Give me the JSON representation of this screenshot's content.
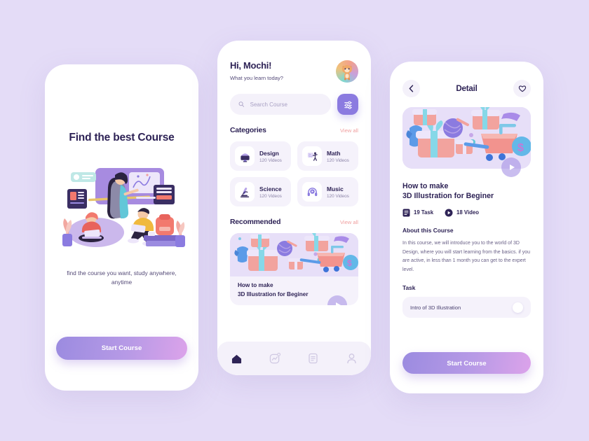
{
  "theme": {
    "background": "#E4DCF7",
    "card": "#FFFFFF",
    "accent_purple": "#8B7BE0",
    "accent_pink": "#DCA3EA",
    "text_dark": "#2E2356",
    "text_muted": "#6B6288",
    "link_pink": "#F0A0A0",
    "soft_lavender": "#F5F2FB"
  },
  "onboarding": {
    "title": "Find the best Course",
    "subtitle": "find the course you want, study anywhere, anytime",
    "cta_label": "Start Course",
    "illustration_name": "online-learning-illustration"
  },
  "home": {
    "greeting": "Hi, Mochi!",
    "greeting_sub": "What you learn today?",
    "avatar_name": "user-avatar-cat",
    "search": {
      "placeholder": "Search Course",
      "value": "",
      "icon": "search-icon"
    },
    "filter_icon": "sliders-filter-icon",
    "categories_section": {
      "title": "Categories",
      "view_all": "View all"
    },
    "categories": [
      {
        "name": "Design",
        "count": "120 Videos",
        "icon": "design-monitor-icon"
      },
      {
        "name": "Math",
        "count": "120 Videos",
        "icon": "math-whiteboard-icon"
      },
      {
        "name": "Science",
        "count": "120 Videos",
        "icon": "science-microscope-icon"
      },
      {
        "name": "Music",
        "count": "120 Videos",
        "icon": "music-headphones-icon"
      }
    ],
    "recommended_section": {
      "title": "Recommended",
      "view_all": "View all"
    },
    "recommended_card": {
      "line1": "How to make",
      "line2": "3D Illustration for Beginer",
      "thumbnail_name": "3d-gifts-illustration",
      "play_icon": "play-icon"
    },
    "bottom_nav": [
      {
        "name": "home-icon",
        "active": true
      },
      {
        "name": "activity-icon",
        "active": false
      },
      {
        "name": "document-icon",
        "active": false
      },
      {
        "name": "profile-icon",
        "active": false
      }
    ]
  },
  "detail": {
    "back_icon": "chevron-left-icon",
    "header_title": "Detail",
    "favorite_icon": "heart-icon",
    "hero_name": "3d-gifts-illustration",
    "play_icon": "play-icon",
    "course_title_line1": "How to make",
    "course_title_line2": "3D Illustration for Beginer",
    "stats": [
      {
        "label": "19 Task",
        "icon": "task-list-icon"
      },
      {
        "label": "18 Video",
        "icon": "play-circle-icon"
      }
    ],
    "about_heading": "About this Course",
    "about_text": "In this course, we will introduce you to the world of 3D Design, where you will start learning from the basics. if you are active, in less than 1 month you can get to the expert level.",
    "task_heading": "Task",
    "tasks": [
      {
        "label": "Intro of 3D Illustration",
        "toggle": "task-toggle-dot"
      }
    ],
    "cta_label": "Start Course"
  }
}
